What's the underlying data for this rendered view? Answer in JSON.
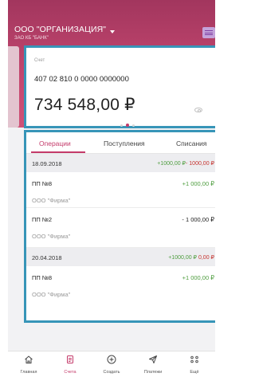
{
  "header": {
    "org_name": "ООО \"ОРГАНИЗАЦИЯ\"",
    "bank_name": "ЗАО КБ \"БАНК\""
  },
  "account_card": {
    "label": "Счет",
    "account_number": "407 02 810 0 0000 0000000",
    "balance": "734 548,00 ₽",
    "pager": {
      "pages": 3,
      "active": 2
    }
  },
  "tabs": [
    {
      "label": "Операции",
      "active": true
    },
    {
      "label": "Поступления",
      "active": false
    },
    {
      "label": "Списания",
      "active": false
    }
  ],
  "groups": [
    {
      "date": "18.09.2018",
      "income": "+1000,00 ₽",
      "expense": "- 1000,00 ₽",
      "items": [
        {
          "doc": "ПП №8",
          "party": "ООО \"Фирма\"",
          "amount": "+1 000,00 ₽"
        },
        {
          "doc": "ПП №2",
          "party": "ООО \"Фирма\"",
          "amount": "- 1 000,00 ₽"
        }
      ]
    },
    {
      "date": "20.04.2018",
      "income": "+1000,00 ₽",
      "expense": "0,00 ₽",
      "items": [
        {
          "doc": "ПП №8",
          "party": "ООО \"Фирма\"",
          "amount": "+1 000,00 ₽"
        }
      ]
    }
  ],
  "bottom_nav": [
    {
      "label": "Главная",
      "icon": "home-icon",
      "active": false
    },
    {
      "label": "Счета",
      "icon": "document-icon",
      "active": true
    },
    {
      "label": "Создать",
      "icon": "plus-circle-icon",
      "active": false
    },
    {
      "label": "Платежи",
      "icon": "send-icon",
      "active": false
    },
    {
      "label": "Ещё",
      "icon": "more-icon",
      "active": false
    }
  ],
  "colors": {
    "accent": "#c43a6a",
    "income": "#4e9d3f",
    "expense": "#c6342f",
    "highlight": "#3795b8"
  }
}
